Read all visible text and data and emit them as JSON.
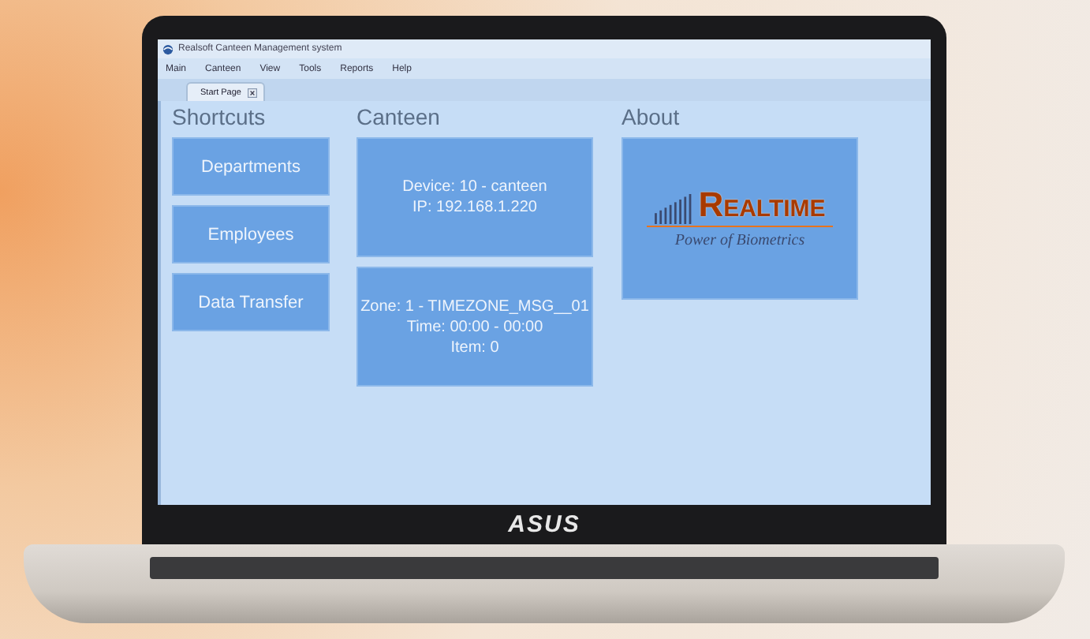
{
  "window": {
    "title": "Realsoft Canteen Management system"
  },
  "menu": [
    "Main",
    "Canteen",
    "View",
    "Tools",
    "Reports",
    "Help"
  ],
  "tabs": [
    {
      "label": "Start Page",
      "selected": true
    }
  ],
  "shortcuts": {
    "heading": "Shortcuts",
    "buttons": [
      "Departments",
      "Employees",
      "Data Transfer"
    ]
  },
  "canteen": {
    "heading": "Canteen",
    "cards": [
      {
        "lines": [
          "Device: 10 - canteen",
          "IP: 192.168.1.220"
        ]
      },
      {
        "lines": [
          "Zone: 1 - TIMEZONE_MSG__01",
          "Time: 00:00 - 00:00",
          "Item: 0"
        ]
      }
    ]
  },
  "about": {
    "heading": "About",
    "logo": {
      "name": "REALTIME",
      "tagline": "Power of Biometrics"
    }
  },
  "laptop": {
    "brand": "ASUS"
  }
}
